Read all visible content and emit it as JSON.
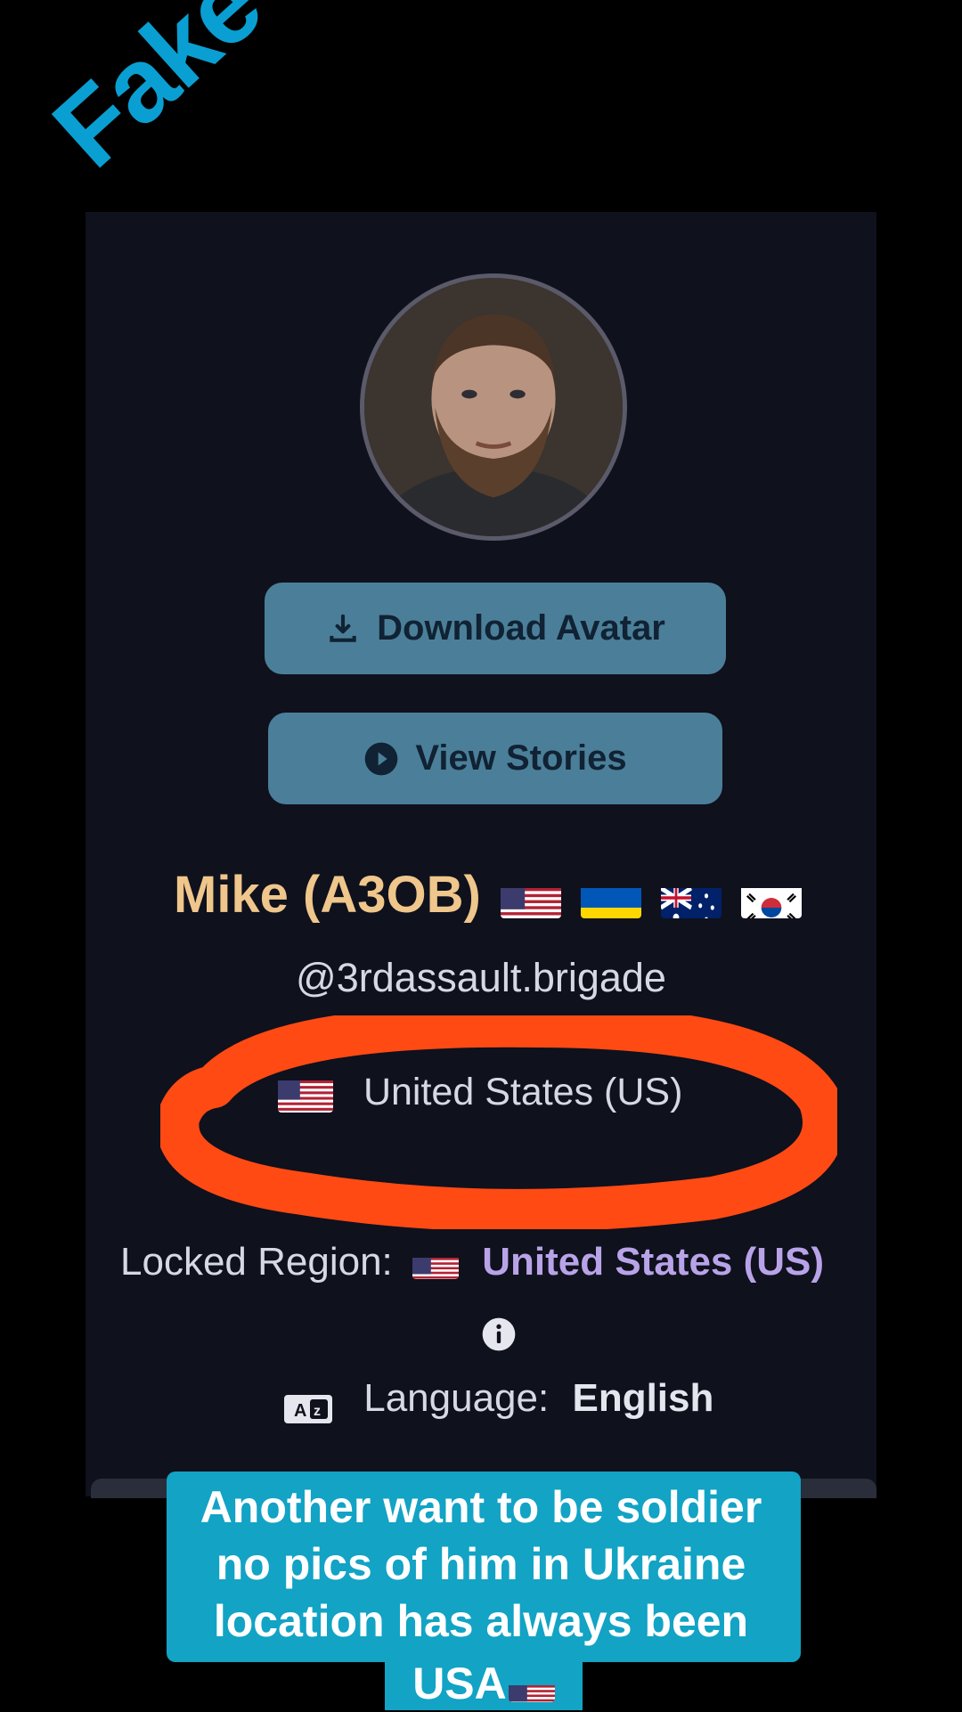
{
  "overlay": {
    "stamp": "Fake"
  },
  "profile": {
    "download_label": "Download Avatar",
    "stories_label": "View Stories",
    "display_name": "Mike (A3OB)",
    "name_flags": [
      "us",
      "ua",
      "au",
      "kr"
    ],
    "handle": "@3rdassault.brigade",
    "country": "United States (US)",
    "locked_region_label": "Locked Region:",
    "locked_region_value": "United States (US)",
    "language_label": "Language:",
    "language_value": "English"
  },
  "caption": {
    "lines": [
      "Another want to be soldier",
      "no pics of him in Ukraine",
      "location has always been"
    ],
    "last_line": "USA"
  },
  "colors": {
    "background": "#000000",
    "panel": "#0f111d",
    "button": "#4b7f99",
    "name": "#efc68b",
    "locked_value": "#b9a3e8",
    "circle_annotation": "#ff4a14",
    "caption_bg": "#12a3c5"
  },
  "icons": [
    "download-icon",
    "play-circle-icon",
    "info-icon",
    "translate-icon"
  ]
}
